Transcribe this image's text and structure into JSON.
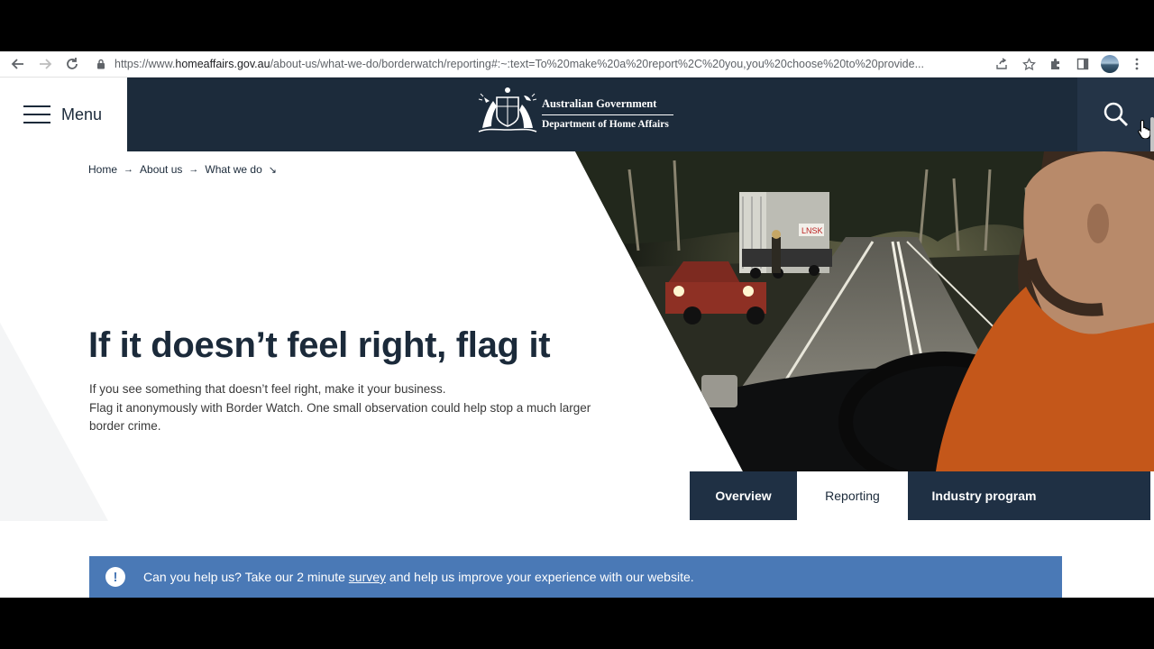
{
  "browser": {
    "url_prefix": "https://www.",
    "url_host": "homeaffairs.gov.au",
    "url_rest": "/about-us/what-we-do/borderwatch/reporting#:~:text=To%20make%20a%20report%2C%20you,you%20choose%20to%20provide..."
  },
  "header": {
    "menu_label": "Menu",
    "gov_line1": "Australian Government",
    "gov_line2": "Department of Home Affairs"
  },
  "breadcrumb": [
    {
      "label": "Home"
    },
    {
      "label": "About us"
    },
    {
      "label": "What we do"
    }
  ],
  "hero": {
    "title": "If it doesn’t feel right, flag it",
    "line1": "If you see something that doesn’t feel right, make it your business.",
    "line2": "Flag it anonymously with Border Watch. One small observation could help stop a much larger border crime."
  },
  "tabs": [
    {
      "label": "Overview",
      "active": false
    },
    {
      "label": "Reporting",
      "active": true
    },
    {
      "label": "Industry program",
      "active": false
    }
  ],
  "survey": {
    "text_before": "Can you help us? Take our 2 minute ",
    "link": "survey",
    "text_after": " and help us improve your experience with our website."
  },
  "colors": {
    "navy": "#1c2b3b",
    "survey_blue": "#4a79b6"
  }
}
